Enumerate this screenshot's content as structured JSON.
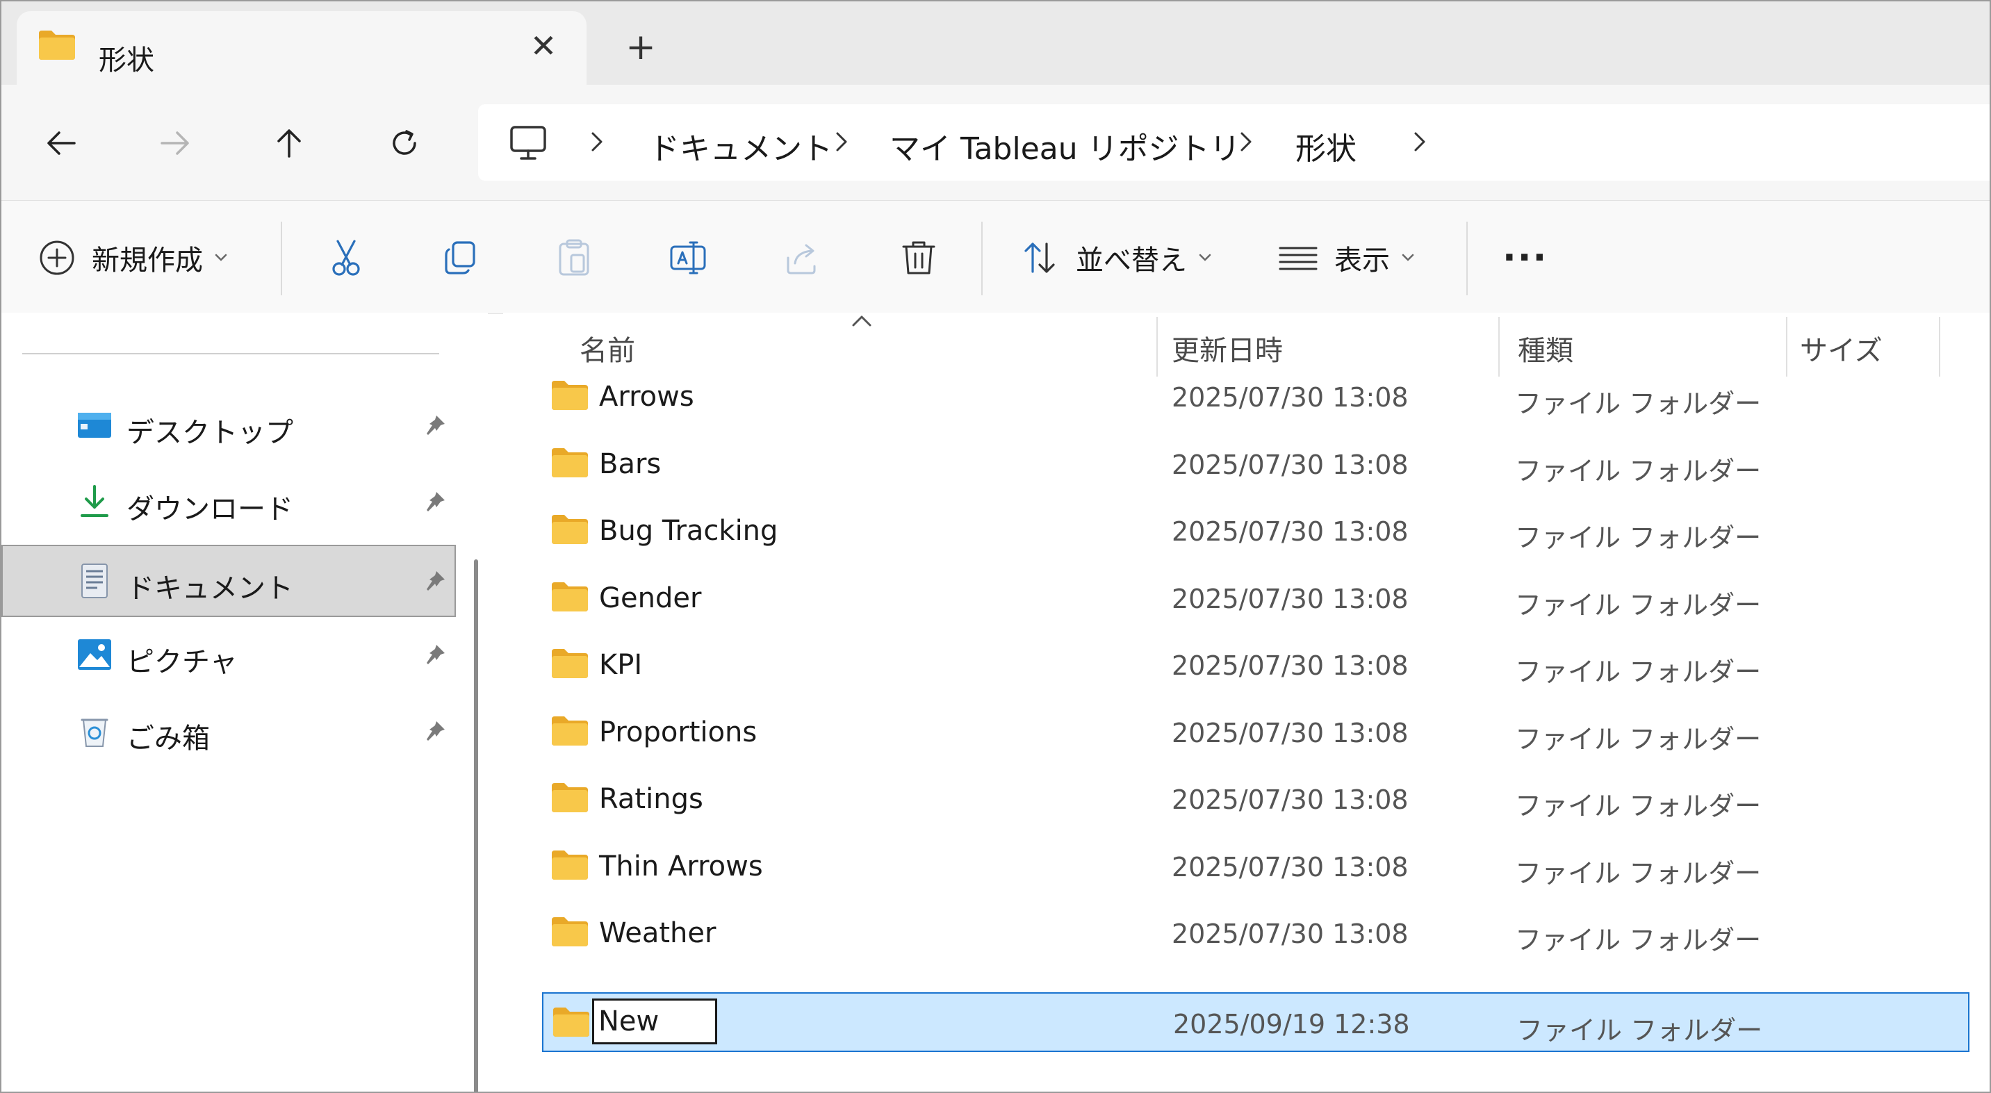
{
  "tab": {
    "title": "形状",
    "close_glyph": "✕",
    "new_glyph": "+"
  },
  "breadcrumb": [
    "ドキュメント",
    "マイ Tableau リポジトリ",
    "形状"
  ],
  "toolbar": {
    "new_label": "新規作成",
    "sort_label": "並べ替え",
    "view_label": "表示",
    "more_glyph": "···"
  },
  "sidebar": {
    "items": [
      {
        "label": "デスクトップ",
        "icon": "desktop-icon"
      },
      {
        "label": "ダウンロード",
        "icon": "download-icon"
      },
      {
        "label": "ドキュメント",
        "icon": "documents-icon",
        "selected": true
      },
      {
        "label": "ピクチャ",
        "icon": "pictures-icon"
      },
      {
        "label": "ごみ箱",
        "icon": "recycle-bin-icon"
      }
    ]
  },
  "columns": {
    "name": "名前",
    "modified": "更新日時",
    "type": "種類",
    "size": "サイズ"
  },
  "files": [
    {
      "name": "Arrows",
      "modified": "2025/07/30 13:08",
      "type": "ファイル フォルダー"
    },
    {
      "name": "Bars",
      "modified": "2025/07/30 13:08",
      "type": "ファイル フォルダー"
    },
    {
      "name": "Bug Tracking",
      "modified": "2025/07/30 13:08",
      "type": "ファイル フォルダー"
    },
    {
      "name": "Gender",
      "modified": "2025/07/30 13:08",
      "type": "ファイル フォルダー"
    },
    {
      "name": "KPI",
      "modified": "2025/07/30 13:08",
      "type": "ファイル フォルダー"
    },
    {
      "name": "Proportions",
      "modified": "2025/07/30 13:08",
      "type": "ファイル フォルダー"
    },
    {
      "name": "Ratings",
      "modified": "2025/07/30 13:08",
      "type": "ファイル フォルダー"
    },
    {
      "name": "Thin Arrows",
      "modified": "2025/07/30 13:08",
      "type": "ファイル フォルダー"
    },
    {
      "name": "Weather",
      "modified": "2025/07/30 13:08",
      "type": "ファイル フォルダー"
    }
  ],
  "new_folder": {
    "name": "New",
    "modified": "2025/09/19 12:38",
    "type": "ファイル フォルダー"
  },
  "colors": {
    "selection": "#cce8ff",
    "selection_border": "#1a74d0",
    "accent": "#0078d4",
    "folder": "#f6c350"
  }
}
